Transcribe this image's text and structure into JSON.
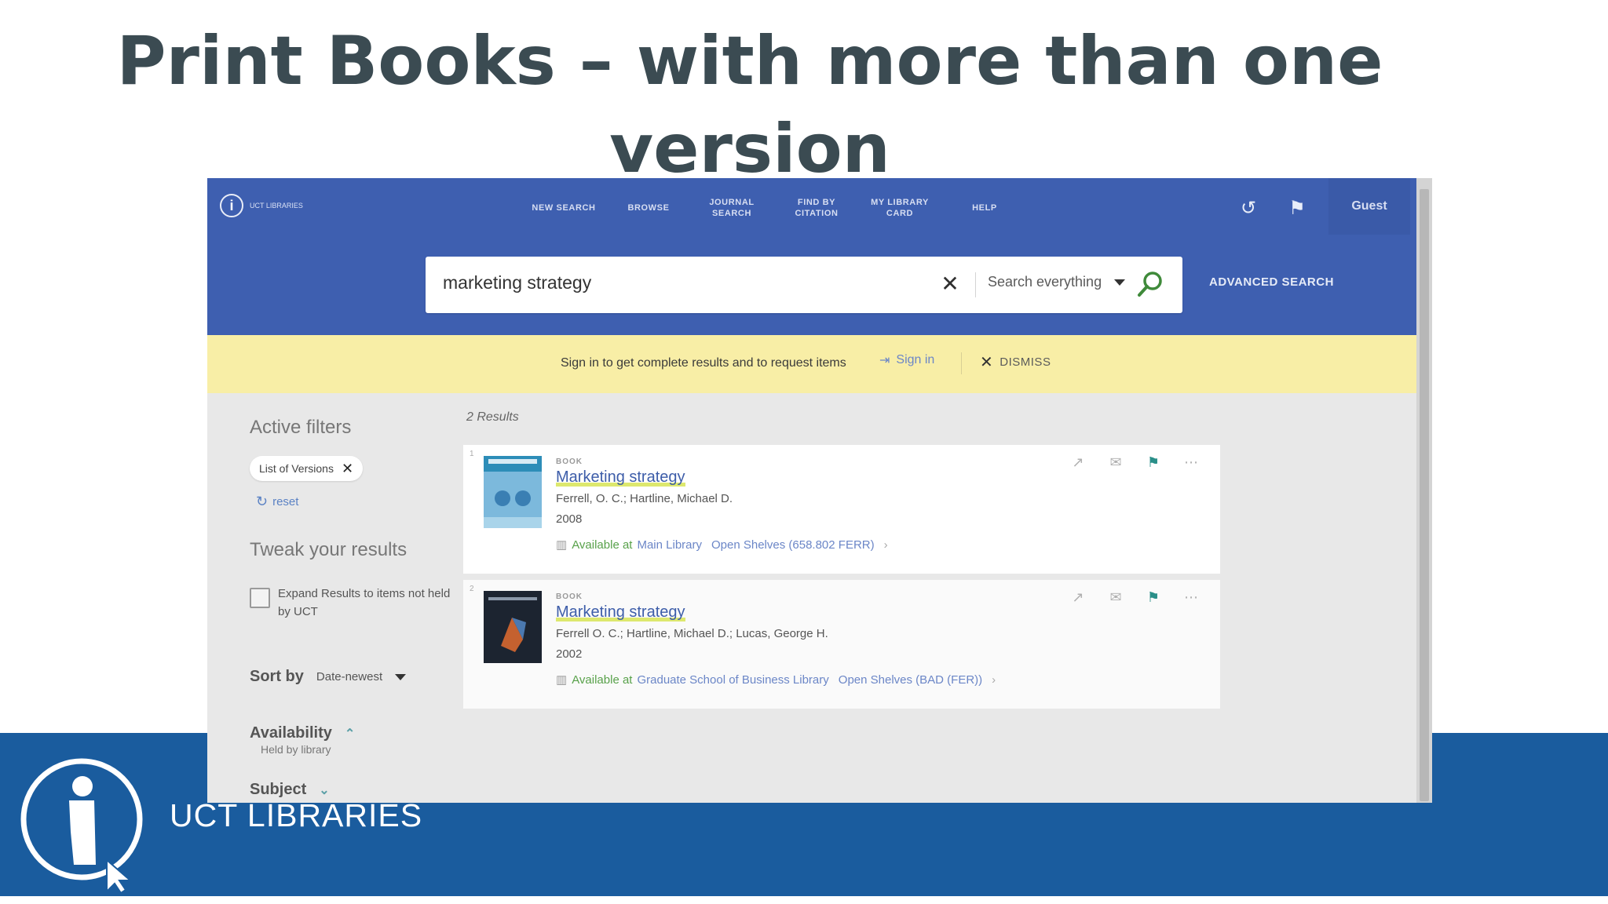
{
  "slide": {
    "title": "Print Books – with more than one version",
    "footer_brand": "UCT LIBRARIES"
  },
  "app": {
    "brand_mini": "UCT LIBRARIES",
    "nav": [
      {
        "label": "NEW SEARCH"
      },
      {
        "label": "BROWSE"
      },
      {
        "label": "JOURNAL SEARCH"
      },
      {
        "label": "FIND BY CITATION"
      },
      {
        "label": "MY LIBRARY CARD"
      },
      {
        "label": "HELP"
      }
    ],
    "user_label": "Guest",
    "search": {
      "value": "marketing strategy",
      "scope": "Search everything",
      "advanced": "ADVANCED SEARCH"
    },
    "notice": {
      "text": "Sign in to get complete results and to request items",
      "signin": "Sign in",
      "dismiss": "DISMISS"
    },
    "sidebar": {
      "active_filters_heading": "Active filters",
      "filter_chip": "List of Versions",
      "reset": "reset",
      "tweak_heading": "Tweak your results",
      "expand_label": "Expand Results to items not held by UCT",
      "sort_label": "Sort by",
      "sort_value": "Date-newest",
      "availability_label": "Availability",
      "availability_option": "Held by library",
      "subject_label": "Subject"
    },
    "results": {
      "count": "2 Results",
      "items": [
        {
          "index": "1",
          "type": "BOOK",
          "title": "Marketing strategy",
          "authors": "Ferrell, O. C.; Hartline, Michael D.",
          "year": "2008",
          "status": "Available at",
          "location": "Main Library",
          "shelf": "Open Shelves (658.802 FERR)"
        },
        {
          "index": "2",
          "type": "BOOK",
          "title": "Marketing strategy",
          "authors": "Ferrell O. C.; Hartline, Michael D.; Lucas, George H.",
          "year": "2002",
          "status": "Available at",
          "location": "Graduate School of Business Library",
          "shelf": "Open Shelves (BAD (FER))"
        }
      ]
    }
  },
  "colors": {
    "title": "#3b4b52",
    "footer": "#1a5c9e",
    "primo_header": "#3e5fb0",
    "notice_bar": "#f8eea6",
    "available": "#58a14a",
    "link": "#6b86c7",
    "pin": "#2a8f89"
  },
  "icons": [
    "search-icon",
    "clear-icon",
    "history-icon",
    "pin-icon",
    "signin-icon",
    "close-icon",
    "reset-icon",
    "link-icon",
    "email-icon",
    "more-icon",
    "book-icon"
  ]
}
